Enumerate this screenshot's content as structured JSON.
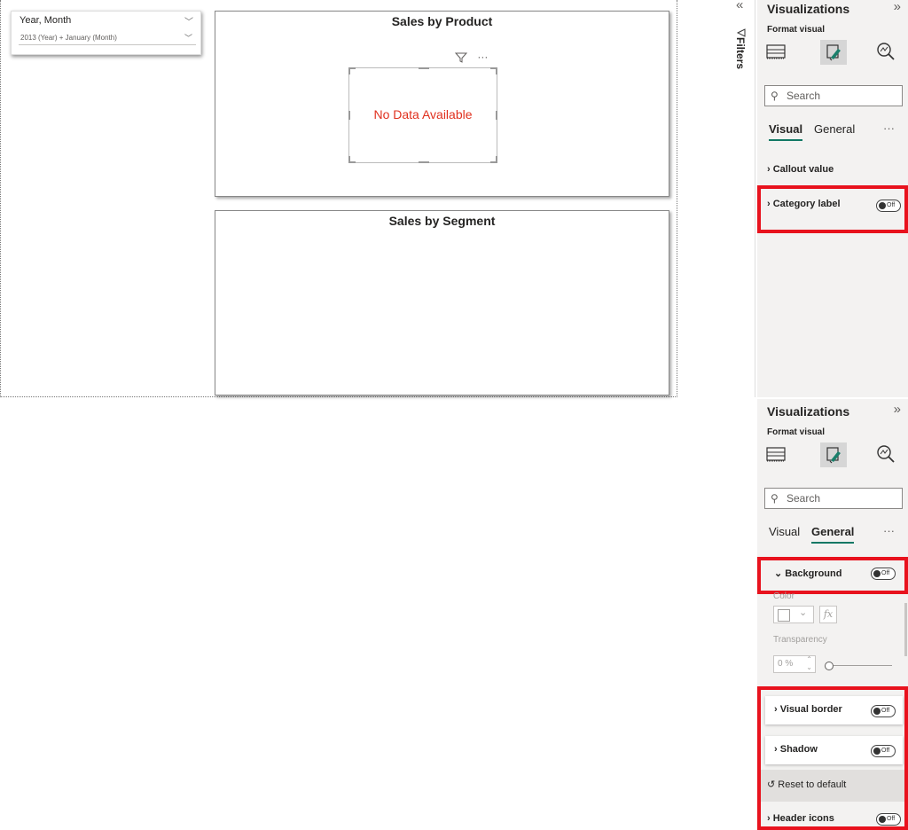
{
  "slicer": {
    "header": "Year, Month",
    "value": "2013 (Year) + January (Month)"
  },
  "visual_product": {
    "title": "Sales by Product",
    "no_data": "No Data Available"
  },
  "visual_segment": {
    "title": "Sales by Segment"
  },
  "filters": {
    "label": "Filters"
  },
  "pane_top": {
    "title": "Visualizations",
    "format_label": "Format visual",
    "search_placeholder": "Search",
    "tabs": {
      "visual": "Visual",
      "general": "General",
      "active": "Visual"
    },
    "sections": {
      "callout": "Callout value",
      "category": "Category label"
    },
    "toggle_text": "Off"
  },
  "pane_bottom": {
    "title": "Visualizations",
    "format_label": "Format visual",
    "search_placeholder": "Search",
    "tabs": {
      "visual": "Visual",
      "general": "General",
      "active": "General"
    },
    "background": "Background",
    "color_label": "Color",
    "transparency_label": "Transparency",
    "transparency_value": "0 %",
    "visual_border": "Visual border",
    "shadow": "Shadow",
    "reset": "Reset to default",
    "header_icons": "Header icons",
    "toggle_text": "Off"
  },
  "colors": {
    "highlight": "#e8121d",
    "accent": "#117865",
    "no_data": "#e0301e",
    "pane_bg": "#f3f2f1"
  }
}
